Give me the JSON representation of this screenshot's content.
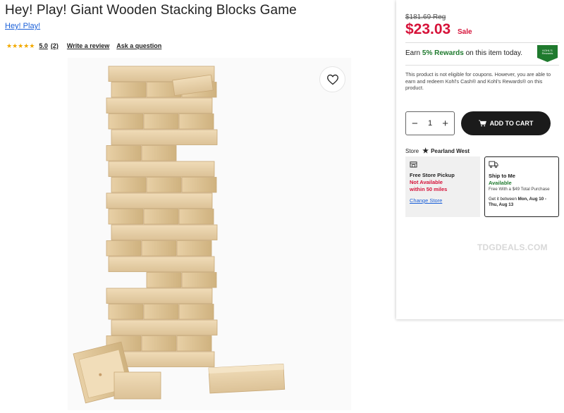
{
  "product": {
    "title": "Hey! Play! Giant Wooden Stacking Blocks Game",
    "brand": "Hey! Play!",
    "rating": "5.0",
    "review_count": "(2)",
    "write_review": "Write a review",
    "ask_question": "Ask a question"
  },
  "pricing": {
    "regular": "$181.69 Reg",
    "sale_price": "$23.03",
    "sale_label": "Sale"
  },
  "rewards": {
    "prefix": "Earn ",
    "amount": "5% Rewards",
    "suffix": " on this item today.",
    "badge_text": "KOHL'S Rewards",
    "note": "This product is not eligible for coupons. However, you are able to earn and redeem Kohl's Cash® and Kohl's Rewards® on this product."
  },
  "cart": {
    "quantity": "1",
    "add_to_cart": "ADD TO CART"
  },
  "store": {
    "label": "Store",
    "name": "Pearland West"
  },
  "fulfillment": {
    "pickup": {
      "title": "Free Store Pickup",
      "status_line1": "Not Available",
      "status_line2": "within 50 miles",
      "change_link": "Change Store"
    },
    "ship": {
      "title": "Ship to Me",
      "status": "Available",
      "detail": "Free With a $49 Total Purchase",
      "get_it_prefix": "Get it between ",
      "get_it_dates": "Mon, Aug 10 - Thu, Aug 13"
    }
  },
  "watermark": "TDGDEALS.COM",
  "colors": {
    "sale_red": "#d6133a",
    "rewards_green": "#1f7a2e",
    "link_blue": "#1a5fd8",
    "star_gold": "#f2a900",
    "cart_button": "#1b1b1b"
  },
  "icons": [
    "star-icon",
    "heart-icon",
    "minus-icon",
    "plus-icon",
    "cart-icon",
    "store-star-icon",
    "store-building-icon",
    "truck-icon"
  ]
}
